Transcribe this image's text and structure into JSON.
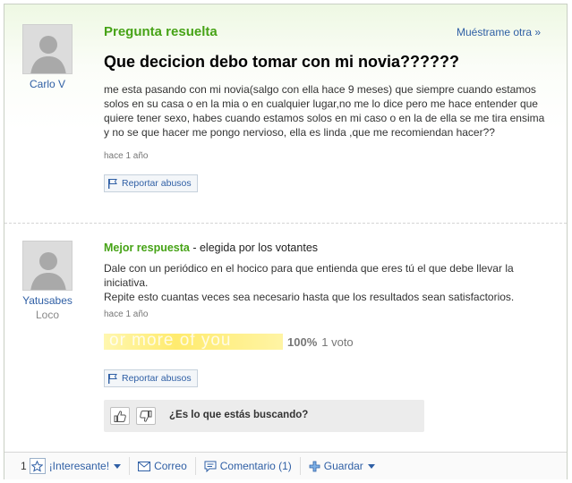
{
  "question": {
    "status_label": "Pregunta resuelta",
    "more_link": "Muéstrame otra »",
    "title": "Que decicion debo tomar con mi novia??????",
    "body": "me esta pasando con mi novia(salgo con ella hace 9 meses) que siempre cuando estamos solos en su casa o en la mia o en cualquier lugar,no me lo dice pero me hace entender que quiere tener sexo, habes cuando estamos solos en mi caso o en la de ella se me tira ensima y no se que hacer me pongo nervioso, ella es linda ,que me recomiendan hacer??",
    "time": "hace 1 año",
    "report_label": "Reportar abusos",
    "asker": {
      "name": "Carlo V"
    }
  },
  "best_answer": {
    "label": "Mejor respuesta",
    "chosen_by": " - elegida por los votantes",
    "body_line1": "Dale con un periódico en el hocico para que entienda que eres tú el que debe llevar la iniciativa.",
    "body_line2": "Repite esto cuantas veces sea necesario hasta que los resultados sean satisfactorios.",
    "time": "hace 1 año",
    "rating_percent": "100%",
    "rating_votes": "1 voto",
    "rating_fill": 1.0,
    "bar_watermark": "or more of you",
    "report_label": "Reportar abusos",
    "feedback_question": "¿Es lo que estás buscando?",
    "answerer": {
      "name": "Yatusabes",
      "level": "Loco"
    }
  },
  "footer": {
    "interesting_count": "1",
    "interesting_label": "¡Interesante!",
    "mail_label": "Correo",
    "comment_label": "Comentario (1)",
    "save_label": "Guardar"
  },
  "colors": {
    "green": "#46a316",
    "link": "#2f5fa5",
    "header_gradient": "#eef8e3"
  },
  "icons": [
    "user-avatar-icon",
    "flag-icon",
    "thumbs-up-icon",
    "thumbs-down-icon",
    "star-icon",
    "mail-icon",
    "comment-icon",
    "plus-icon",
    "caret-down-icon"
  ]
}
